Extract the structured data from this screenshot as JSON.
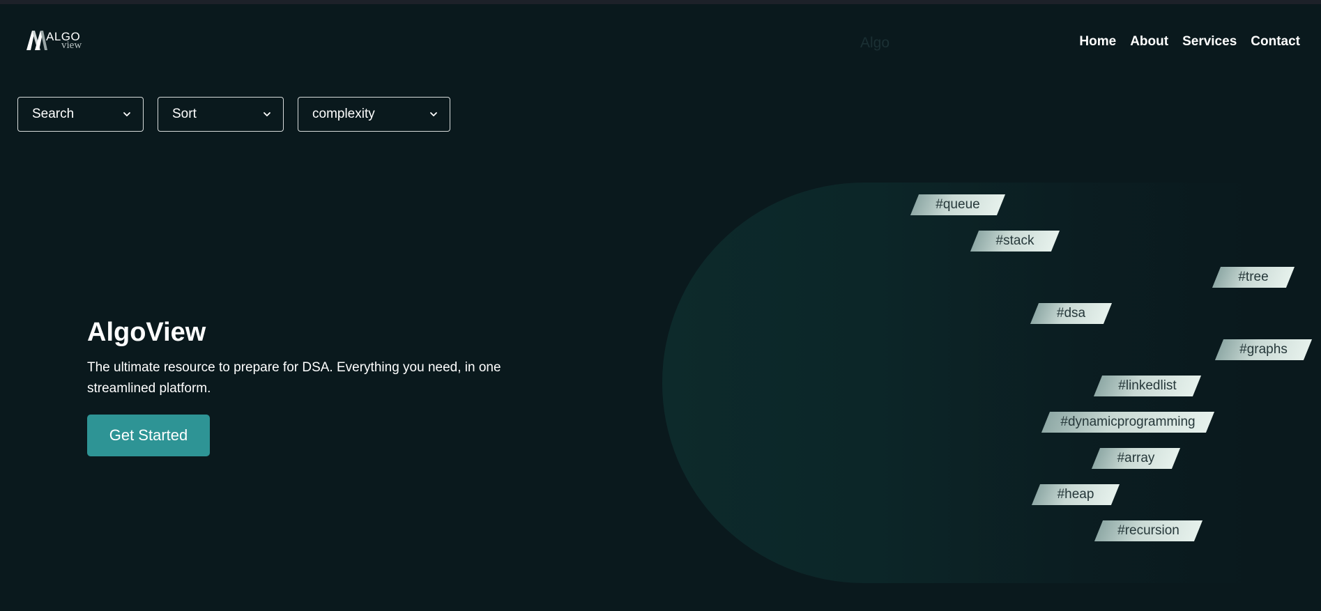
{
  "header": {
    "logo": {
      "algo": "ALGO",
      "view": "view",
      "icon": "algoview-logo-icon"
    },
    "center_text": "Algo",
    "nav": [
      {
        "label": "Home"
      },
      {
        "label": "About"
      },
      {
        "label": "Services"
      },
      {
        "label": "Contact"
      }
    ]
  },
  "filters": [
    {
      "label": "Search",
      "icon": "chevron-down-icon"
    },
    {
      "label": "Sort",
      "icon": "chevron-down-icon"
    },
    {
      "label": "complexity",
      "icon": "chevron-down-icon"
    }
  ],
  "hero": {
    "title": "AlgoView",
    "description": "The ultimate resource to prepare for DSA. Everything you need, in one streamlined platform.",
    "cta_label": "Get Started"
  },
  "tags": [
    {
      "label": "#queue"
    },
    {
      "label": "#stack"
    },
    {
      "label": "#tree"
    },
    {
      "label": "#dsa"
    },
    {
      "label": "#graphs"
    },
    {
      "label": "#linkedlist"
    },
    {
      "label": "#dynamicprogramming"
    },
    {
      "label": "#array"
    },
    {
      "label": "#heap"
    },
    {
      "label": "#recursion"
    }
  ],
  "colors": {
    "background": "#0a191d",
    "accent": "#2e9495",
    "tag_text": "#26383a"
  }
}
